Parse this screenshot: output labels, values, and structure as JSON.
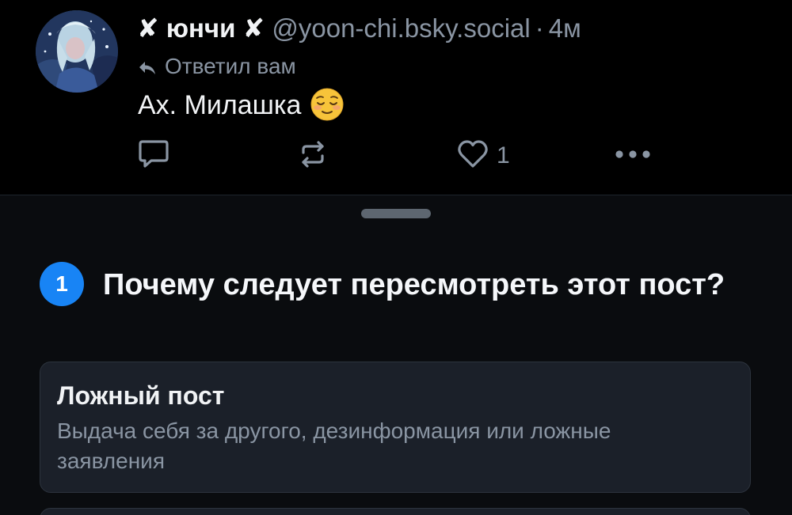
{
  "post": {
    "author_name": "✘ юнчи ✘",
    "author_handle": "@yoon-chi.bsky.social",
    "separator": "·",
    "time": "4м",
    "reply_label": "Ответил вам",
    "text": "Ах. Милашка",
    "emoji": "relieved-face",
    "like_count": "1"
  },
  "sheet": {
    "step_number": "1",
    "question": "Почему следует пересмотреть этот пост?",
    "options": [
      {
        "title": "Ложный пост",
        "description": "Выдача себя за другого, дезинформация или ложные заявления"
      }
    ]
  },
  "colors": {
    "background": "#000000",
    "sheet_background": "#0a0c0f",
    "card_background": "#1b2029",
    "muted_text": "#8a95a3",
    "accent": "#1884f5"
  }
}
